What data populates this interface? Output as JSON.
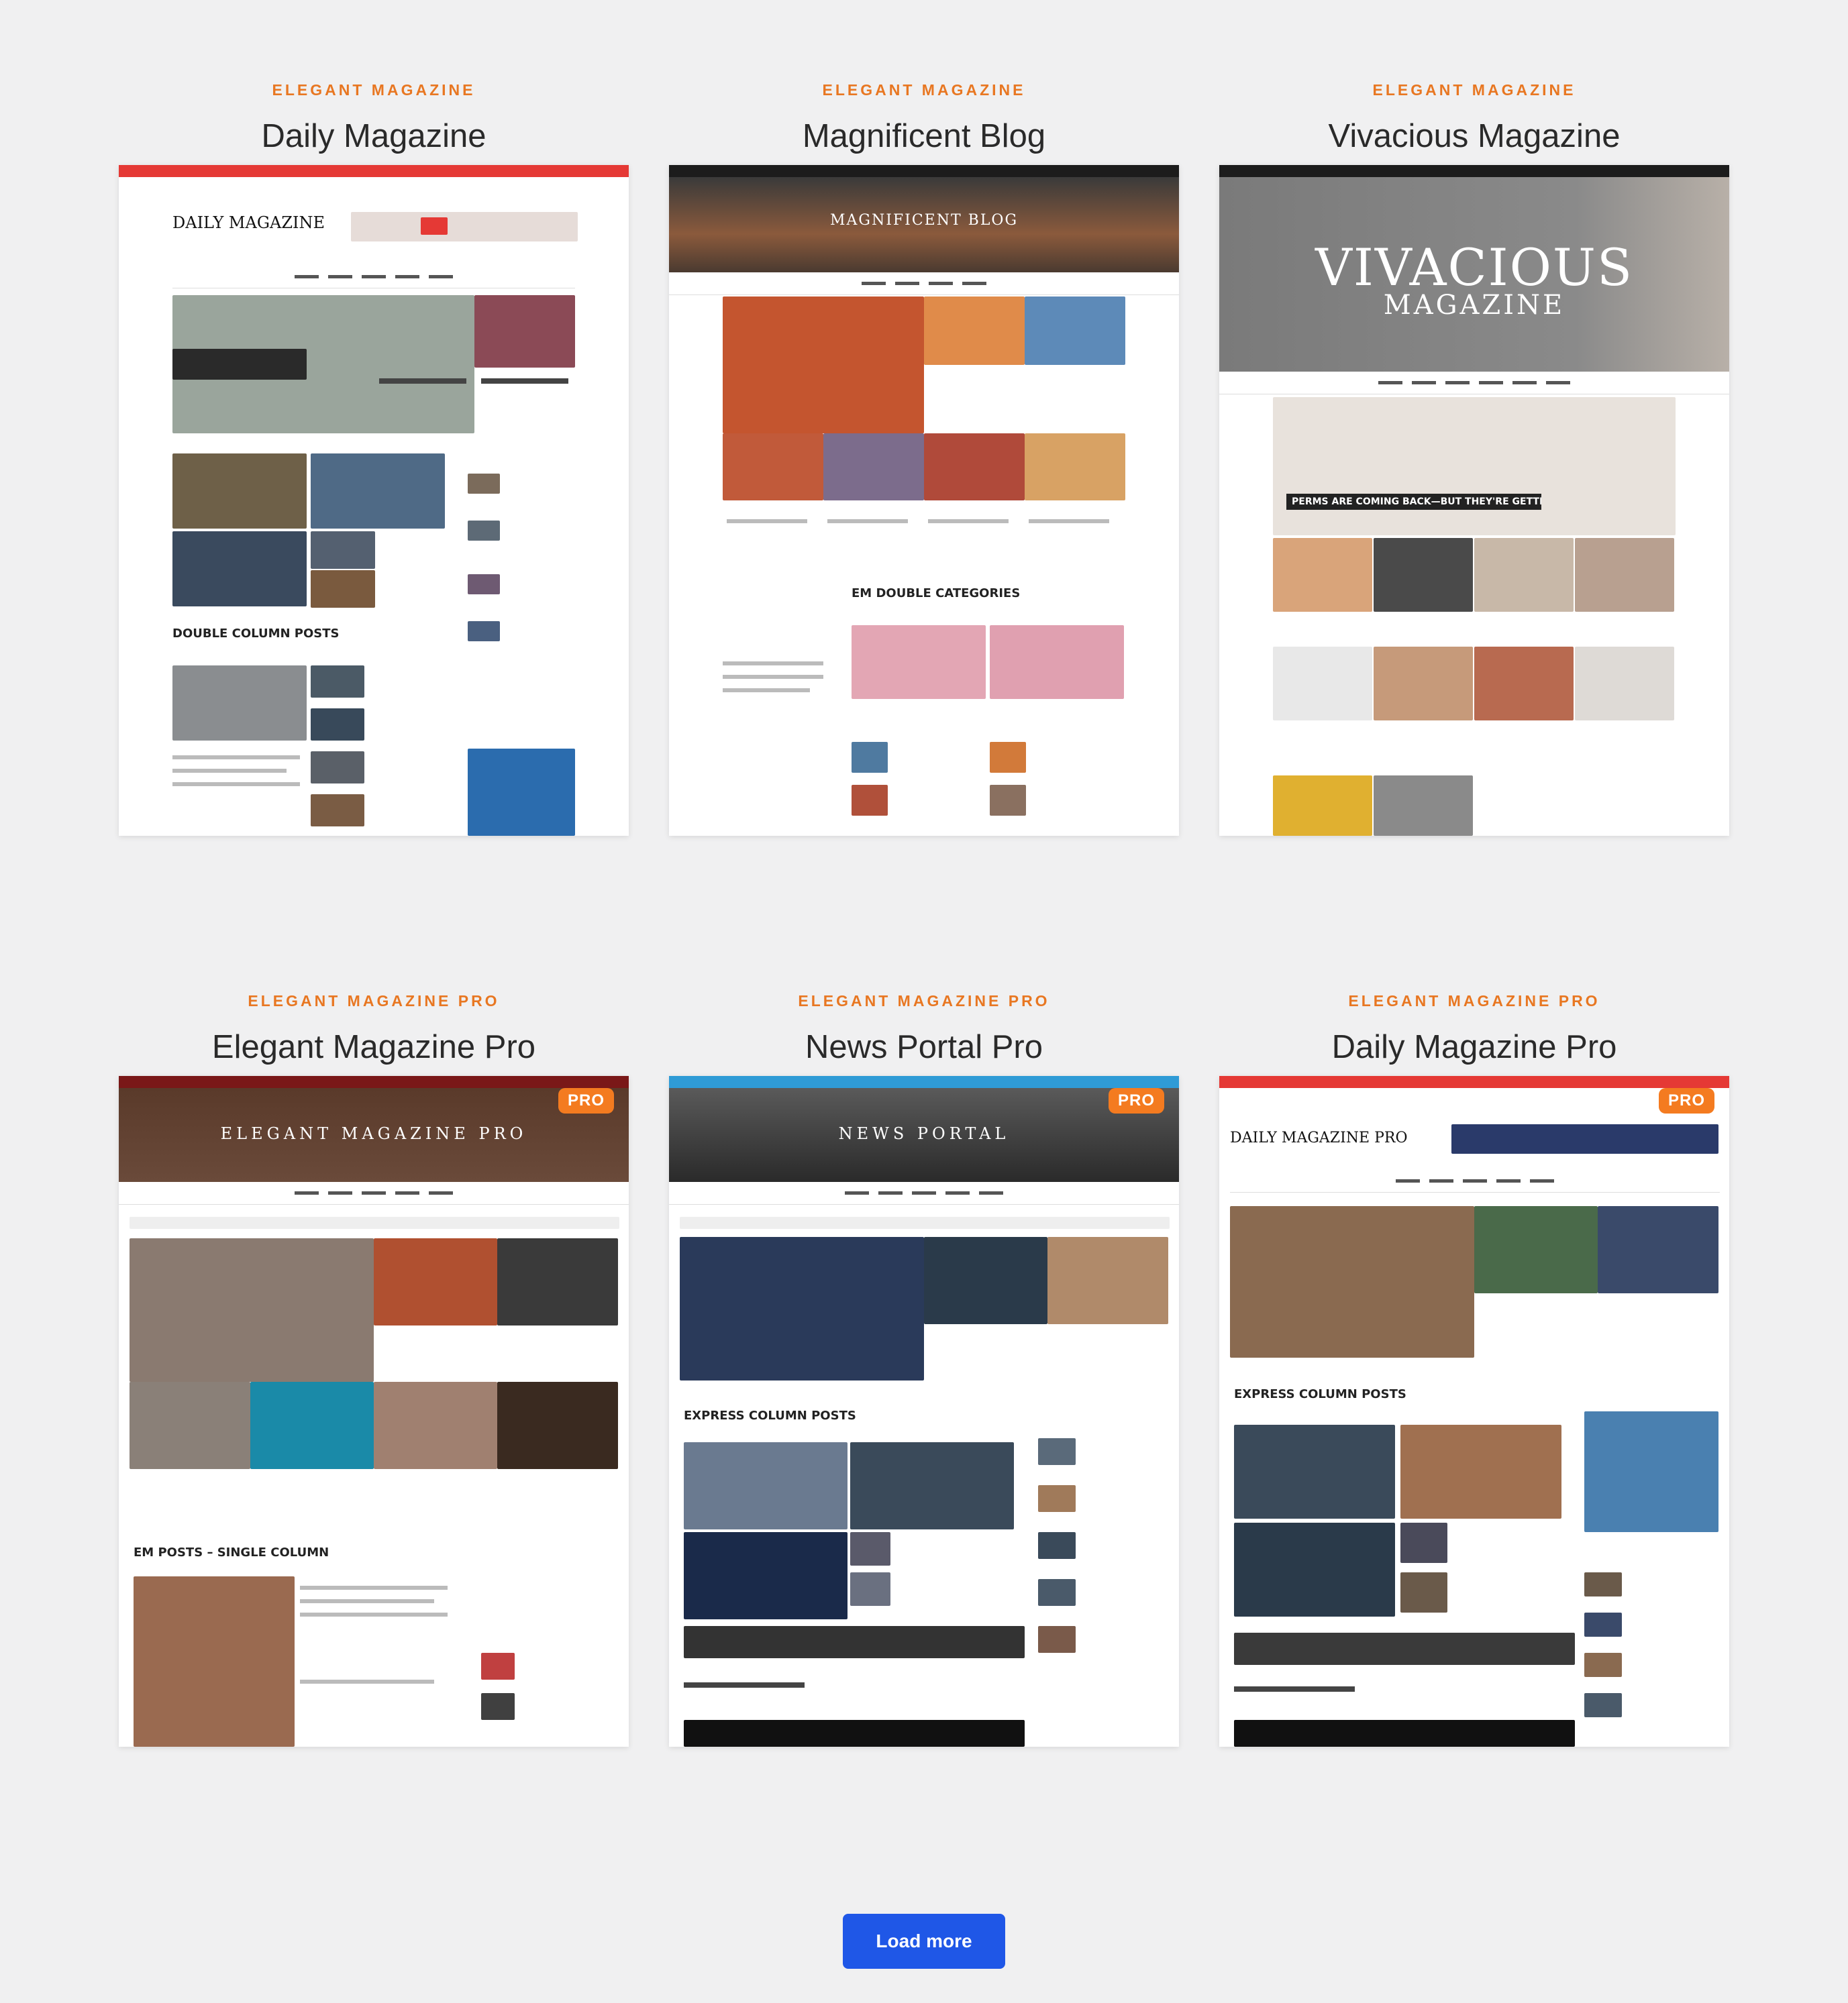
{
  "cards": [
    {
      "subtitle": "ELEGANT MAGAZINE",
      "title": "Daily Magazine",
      "pro": false,
      "preview_masthead": "DAILY MAGAZINE",
      "section_label": "DOUBLE COLUMN POSTS"
    },
    {
      "subtitle": "ELEGANT MAGAZINE",
      "title": "Magnificent Blog",
      "pro": false,
      "preview_masthead": "MAGNIFICENT BLOG",
      "section_label": "EM DOUBLE CATEGORIES"
    },
    {
      "subtitle": "ELEGANT MAGAZINE",
      "title": "Vivacious Magazine",
      "pro": false,
      "preview_masthead": "VIVACIOUS",
      "preview_masthead_2": "MAGAZINE",
      "section_label": "PERMS ARE COMING BACK—BUT THEY'RE GETTING A MODERN"
    },
    {
      "subtitle": "ELEGANT MAGAZINE PRO",
      "title": "Elegant Magazine Pro",
      "pro": true,
      "badge": "PRO",
      "preview_masthead": "ELEGANT MAGAZINE PRO",
      "section_label": "EM POSTS – SINGLE COLUMN"
    },
    {
      "subtitle": "ELEGANT MAGAZINE PRO",
      "title": "News Portal Pro",
      "pro": true,
      "badge": "PRO",
      "preview_masthead": "NEWS PORTAL",
      "section_label": "EXPRESS COLUMN POSTS"
    },
    {
      "subtitle": "ELEGANT MAGAZINE PRO",
      "title": "Daily Magazine Pro",
      "pro": true,
      "badge": "PRO",
      "preview_masthead": "DAILY MAGAZINE PRO",
      "section_label": "EXPRESS COLUMN POSTS"
    }
  ],
  "load_more_label": "Load more",
  "colors": {
    "accent_orange": "#e87722",
    "badge_orange": "#f47b20",
    "button_blue": "#1f57e7",
    "page_bg": "#f0f0f1"
  }
}
